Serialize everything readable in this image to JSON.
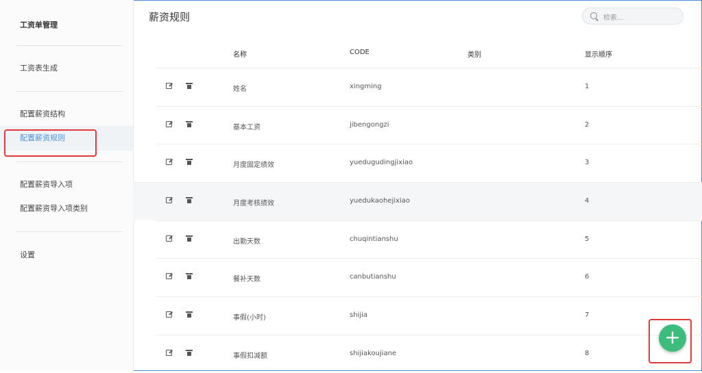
{
  "sidebar": {
    "items": [
      {
        "label": "工资单管理"
      },
      {
        "label": "工资表生成"
      },
      {
        "label": "配置薪资结构"
      },
      {
        "label": "配置薪资规则"
      },
      {
        "label": "配置薪资导入项"
      },
      {
        "label": "配置薪资导入项类别"
      },
      {
        "label": "设置"
      }
    ]
  },
  "header": {
    "title": "薪资规则"
  },
  "search": {
    "placeholder": "检索..."
  },
  "table": {
    "columns": [
      "名称",
      "CODE",
      "类别",
      "显示顺序"
    ],
    "rows": [
      {
        "name": "姓名",
        "code": "xingming",
        "category": "",
        "order": "1"
      },
      {
        "name": "基本工资",
        "code": "jibengongzi",
        "category": "",
        "order": "2"
      },
      {
        "name": "月度固定绩效",
        "code": "yuedugudingjixiao",
        "category": "",
        "order": "3"
      },
      {
        "name": "月度考核绩效",
        "code": "yuedukaohejixiao",
        "category": "",
        "order": "4"
      },
      {
        "name": "出勤天数",
        "code": "chuqintianshu",
        "category": "",
        "order": "5"
      },
      {
        "name": "餐补天数",
        "code": "canbutianshu",
        "category": "",
        "order": "6"
      },
      {
        "name": "事假(小时)",
        "code": "shijia",
        "category": "",
        "order": "7"
      },
      {
        "name": "事假扣减额",
        "code": "shijiakoujiane",
        "category": "",
        "order": "8"
      }
    ]
  },
  "fab": {
    "label": "+"
  },
  "colors": {
    "accent": "#4a90d9",
    "fab": "#3dbd7d",
    "highlight_box": "#e0383b"
  }
}
